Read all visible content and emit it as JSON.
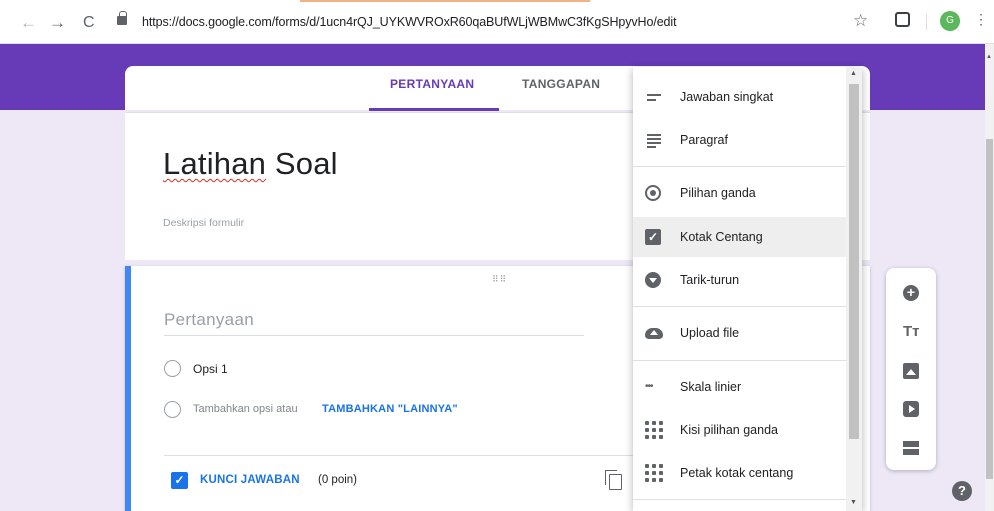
{
  "browser": {
    "url": "https://docs.google.com/forms/d/1ucn4rQJ_UYKWVROxR60qaBUfWLjWBMwC3fKgSHpyvHo/edit",
    "back_icon": "←",
    "forward_icon": "→",
    "reload_icon": "C",
    "star_icon": "☆",
    "menu_icon": "⋮",
    "profile_initial": "G"
  },
  "tabs": {
    "questions": "PERTANYAAN",
    "responses": "TANGGAPAN"
  },
  "form": {
    "title_word1": "Latihan",
    "title_word2": " Soal",
    "description_placeholder": "Deskripsi formulir"
  },
  "question": {
    "drag_handle": "⠿⠿",
    "title_placeholder": "Pertanyaan",
    "option1": "Opsi 1",
    "add_option": "Tambahkan opsi  atau",
    "add_other": "TAMBAHKAN \"LAINNYA\"",
    "answer_key": "KUNCI JAWABAN",
    "points": "(0 poin)"
  },
  "type_menu": {
    "items": [
      {
        "label": "Jawaban singkat",
        "icon": "short-answer-icon"
      },
      {
        "label": "Paragraf",
        "icon": "paragraph-icon"
      },
      {
        "label": "Pilihan ganda",
        "icon": "radio-button-icon"
      },
      {
        "label": "Kotak Centang",
        "icon": "checkbox-icon",
        "highlighted": true
      },
      {
        "label": "Tarik-turun",
        "icon": "dropdown-icon"
      },
      {
        "label": "Upload file",
        "icon": "cloud-upload-icon"
      },
      {
        "label": "Skala linier",
        "icon": "linear-scale-icon"
      },
      {
        "label": "Kisi pilihan ganda",
        "icon": "grid-icon"
      },
      {
        "label": "Petak kotak centang",
        "icon": "grid-icon"
      }
    ]
  },
  "toolbar": {
    "add_question": "+",
    "add_title": "Tт",
    "help": "?"
  },
  "colors": {
    "theme": "#673ab7",
    "accent_blue": "#1a73e8",
    "background": "#ede7f6"
  }
}
